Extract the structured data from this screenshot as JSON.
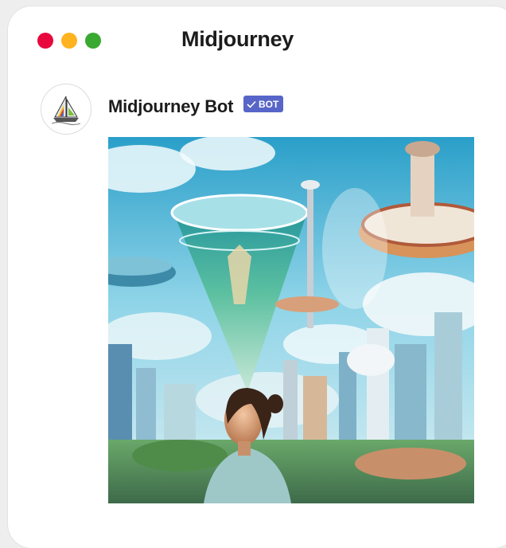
{
  "window": {
    "title": "Midjourney",
    "controls": {
      "close_color": "#e8083e",
      "minimize_color": "#ffb31f",
      "maximize_color": "#3aa931"
    }
  },
  "message": {
    "author": "Midjourney Bot",
    "badge": {
      "label": "BOT",
      "icon": "checkmark-icon",
      "color": "#5865c8"
    },
    "avatar_icon": "sailboat-logo-icon",
    "attachment": {
      "kind": "generated-image",
      "subject": "futuristic city with floating structures and a woman in the foreground"
    }
  }
}
